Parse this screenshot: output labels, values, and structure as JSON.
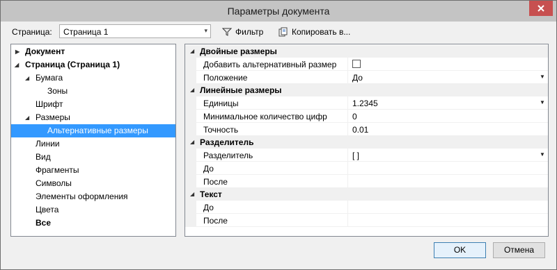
{
  "window": {
    "title": "Параметры документа"
  },
  "toolbar": {
    "page_label": "Страница:",
    "page_value": "Страница 1",
    "filter_label": "Фильтр",
    "copy_label": "Копировать в..."
  },
  "tree": {
    "items": [
      {
        "label": "Документ"
      },
      {
        "label": "Страница (Страница 1)"
      },
      {
        "label": "Бумага"
      },
      {
        "label": "Зоны"
      },
      {
        "label": "Шрифт"
      },
      {
        "label": "Размеры"
      },
      {
        "label": "Альтернативные размеры"
      },
      {
        "label": "Линии"
      },
      {
        "label": "Вид"
      },
      {
        "label": "Фрагменты"
      },
      {
        "label": "Символы"
      },
      {
        "label": "Элементы оформления"
      },
      {
        "label": "Цвета"
      },
      {
        "label": "Все"
      }
    ]
  },
  "grid": {
    "categories": [
      {
        "title": "Двойные размеры",
        "rows": [
          {
            "name": "Добавить альтернативный размер",
            "value": ""
          },
          {
            "name": "Положение",
            "value": "До"
          }
        ]
      },
      {
        "title": "Линейные размеры",
        "rows": [
          {
            "name": "Единицы",
            "value": "1.2345"
          },
          {
            "name": "Минимальное количество цифр",
            "value": "0"
          },
          {
            "name": "Точность",
            "value": "0.01"
          }
        ]
      },
      {
        "title": "Разделитель",
        "rows": [
          {
            "name": "Разделитель",
            "value": "[ ]"
          },
          {
            "name": "До",
            "value": ""
          },
          {
            "name": "После",
            "value": ""
          }
        ]
      },
      {
        "title": "Текст",
        "rows": [
          {
            "name": "До",
            "value": ""
          },
          {
            "name": "После",
            "value": ""
          }
        ]
      }
    ]
  },
  "buttons": {
    "ok": "OK",
    "cancel": "Отмена"
  },
  "colors": {
    "selection": "#3399ff",
    "titlebar": "#c4c4c4",
    "close": "#c75050"
  }
}
